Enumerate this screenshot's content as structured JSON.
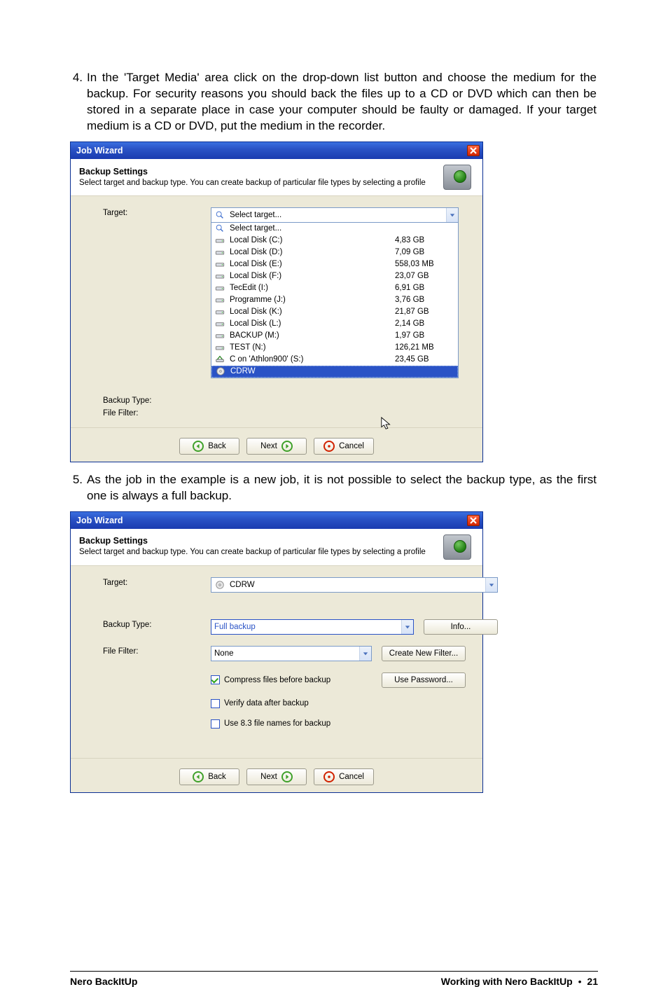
{
  "steps": {
    "s4_num": "4.",
    "s4_text": "In the 'Target Media' area click on the drop-down list button and choose the medium for the backup. For security reasons you should back the files up to a CD or DVD which can then be stored in a separate place in case your computer should be faulty or damaged. If your target medium is a CD or DVD, put the medium in the recorder.",
    "s5_num": "5.",
    "s5_text": "As the job in the example is a new job, it is not possible to select the backup type, as the first one is always a full backup."
  },
  "wiz": {
    "title": "Job Wizard",
    "banner_title": "Backup Settings",
    "banner_desc": "Select target and backup type. You can create backup of particular file types by selecting a profile",
    "labels": {
      "target": "Target:",
      "backup_type": "Backup Type:",
      "file_filter": "File Filter:"
    },
    "buttons": {
      "back": "Back",
      "next": "Next",
      "cancel": "Cancel",
      "info": "Info...",
      "new_filter": "Create New Filter...",
      "use_password": "Use Password..."
    }
  },
  "wiz1": {
    "target_selected": "Select target...",
    "options": [
      {
        "name": "Select target...",
        "size": "",
        "icon": "search"
      },
      {
        "name": "Local Disk (C:)",
        "size": "4,83 GB",
        "icon": "drive"
      },
      {
        "name": "Local Disk (D:)",
        "size": "7,09 GB",
        "icon": "drive"
      },
      {
        "name": "Local Disk (E:)",
        "size": "558,03 MB",
        "icon": "drive"
      },
      {
        "name": "Local Disk (F:)",
        "size": "23,07 GB",
        "icon": "drive"
      },
      {
        "name": "TecEdit (I:)",
        "size": "6,91 GB",
        "icon": "drive"
      },
      {
        "name": "Programme (J:)",
        "size": "3,76 GB",
        "icon": "drive"
      },
      {
        "name": "Local Disk (K:)",
        "size": "21,87 GB",
        "icon": "drive"
      },
      {
        "name": "Local Disk (L:)",
        "size": "2,14 GB",
        "icon": "drive"
      },
      {
        "name": "BACKUP (M:)",
        "size": "1,97 GB",
        "icon": "drive"
      },
      {
        "name": "TEST (N:)",
        "size": "126,21 MB",
        "icon": "drive"
      },
      {
        "name": "C on 'Athlon900' (S:)",
        "size": "23,45 GB",
        "icon": "net"
      },
      {
        "name": "CDRW",
        "size": "",
        "icon": "cd",
        "hilite": true
      }
    ]
  },
  "wiz2": {
    "target_selected": "CDRW",
    "backup_type_selected": "Full backup",
    "file_filter_selected": "None",
    "checks": {
      "compress": "Compress files before backup",
      "verify": "Verify data after backup",
      "names83": "Use 8.3 file names for backup"
    }
  },
  "footer": {
    "left": "Nero BackItUp",
    "right_a": "Working with Nero BackItUp",
    "right_b": "21"
  }
}
